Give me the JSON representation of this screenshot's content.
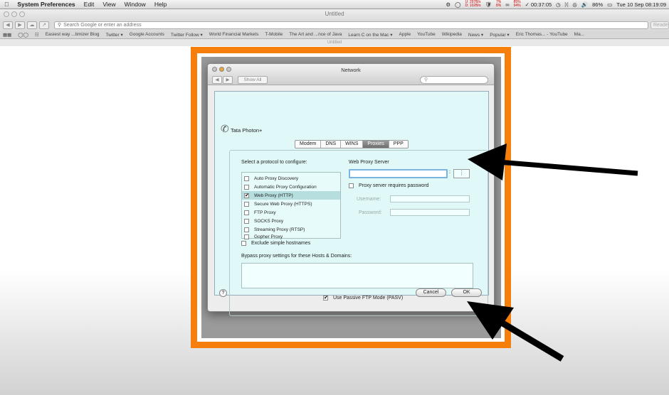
{
  "menubar": {
    "apple_icon": "apple-icon",
    "app_name": "System Preferences",
    "menus": [
      "Edit",
      "View",
      "Window",
      "Help"
    ],
    "net_up": "U: 297B/s",
    "net_down": "D: 102B/s",
    "cpu_pct": "7%",
    "cpu_pct2": "8%",
    "mem_pct": "85%",
    "mem_pct2": "94%",
    "timer": "00:37:05",
    "battery": "86%",
    "clock": "Tue 10 Sep  08:19:09"
  },
  "browser": {
    "window_title": "Untitled",
    "address_placeholder": "Search Google or enter an address",
    "reader_label": "Reader",
    "bookmarks": [
      "Easiest way ...timizer Blog",
      "Twitter ▾",
      "Google Accounts",
      "Twitter Follow ▾",
      "World Financial Markets",
      "T-Mobile",
      "The Art and ...nce of Java",
      "Learn C on the Mac ▾",
      "Apple",
      "YouTube",
      "Wikipedia",
      "News ▾",
      "Popular ▾",
      "Eric Thomas... - YouTube",
      "Ma..."
    ],
    "page_title": "Untitled"
  },
  "network": {
    "window_title": "Network",
    "show_all": "Show All",
    "interface_name": "Tata Photon+",
    "tabs": [
      {
        "label": "Modem",
        "selected": false
      },
      {
        "label": "DNS",
        "selected": false
      },
      {
        "label": "WINS",
        "selected": false
      },
      {
        "label": "Proxies",
        "selected": true
      },
      {
        "label": "PPP",
        "selected": false
      }
    ],
    "select_protocol_label": "Select a protocol to configure:",
    "protocols": [
      {
        "label": "Auto Proxy Discovery",
        "checked": false,
        "selected": false
      },
      {
        "label": "Automatic Proxy Configuration",
        "checked": false,
        "selected": false
      },
      {
        "label": "Web Proxy (HTTP)",
        "checked": true,
        "selected": true
      },
      {
        "label": "Secure Web Proxy (HTTPS)",
        "checked": false,
        "selected": false
      },
      {
        "label": "FTP Proxy",
        "checked": false,
        "selected": false
      },
      {
        "label": "SOCKS Proxy",
        "checked": false,
        "selected": false
      },
      {
        "label": "Streaming Proxy (RTSP)",
        "checked": false,
        "selected": false
      },
      {
        "label": "Gopher Proxy",
        "checked": false,
        "selected": false
      }
    ],
    "web_proxy_server_label": "Web Proxy Server",
    "proxy_host_value": "",
    "proxy_port_separator": ":",
    "requires_password_label": "Proxy server requires password",
    "username_label": "Username:",
    "password_label": "Password:",
    "exclude_simple_label": "Exclude simple hostnames",
    "bypass_label": "Bypass proxy settings for these Hosts & Domains:",
    "bypass_value": "",
    "passive_ftp_label": "Use Passive FTP Mode (PASV)",
    "passive_ftp_checked": true,
    "help_label": "?",
    "cancel_label": "Cancel",
    "ok_label": "OK"
  },
  "colors": {
    "frame_orange": "#f57f0a",
    "sheet_cyan": "#e1f8f8",
    "arrow_black": "#000000"
  }
}
